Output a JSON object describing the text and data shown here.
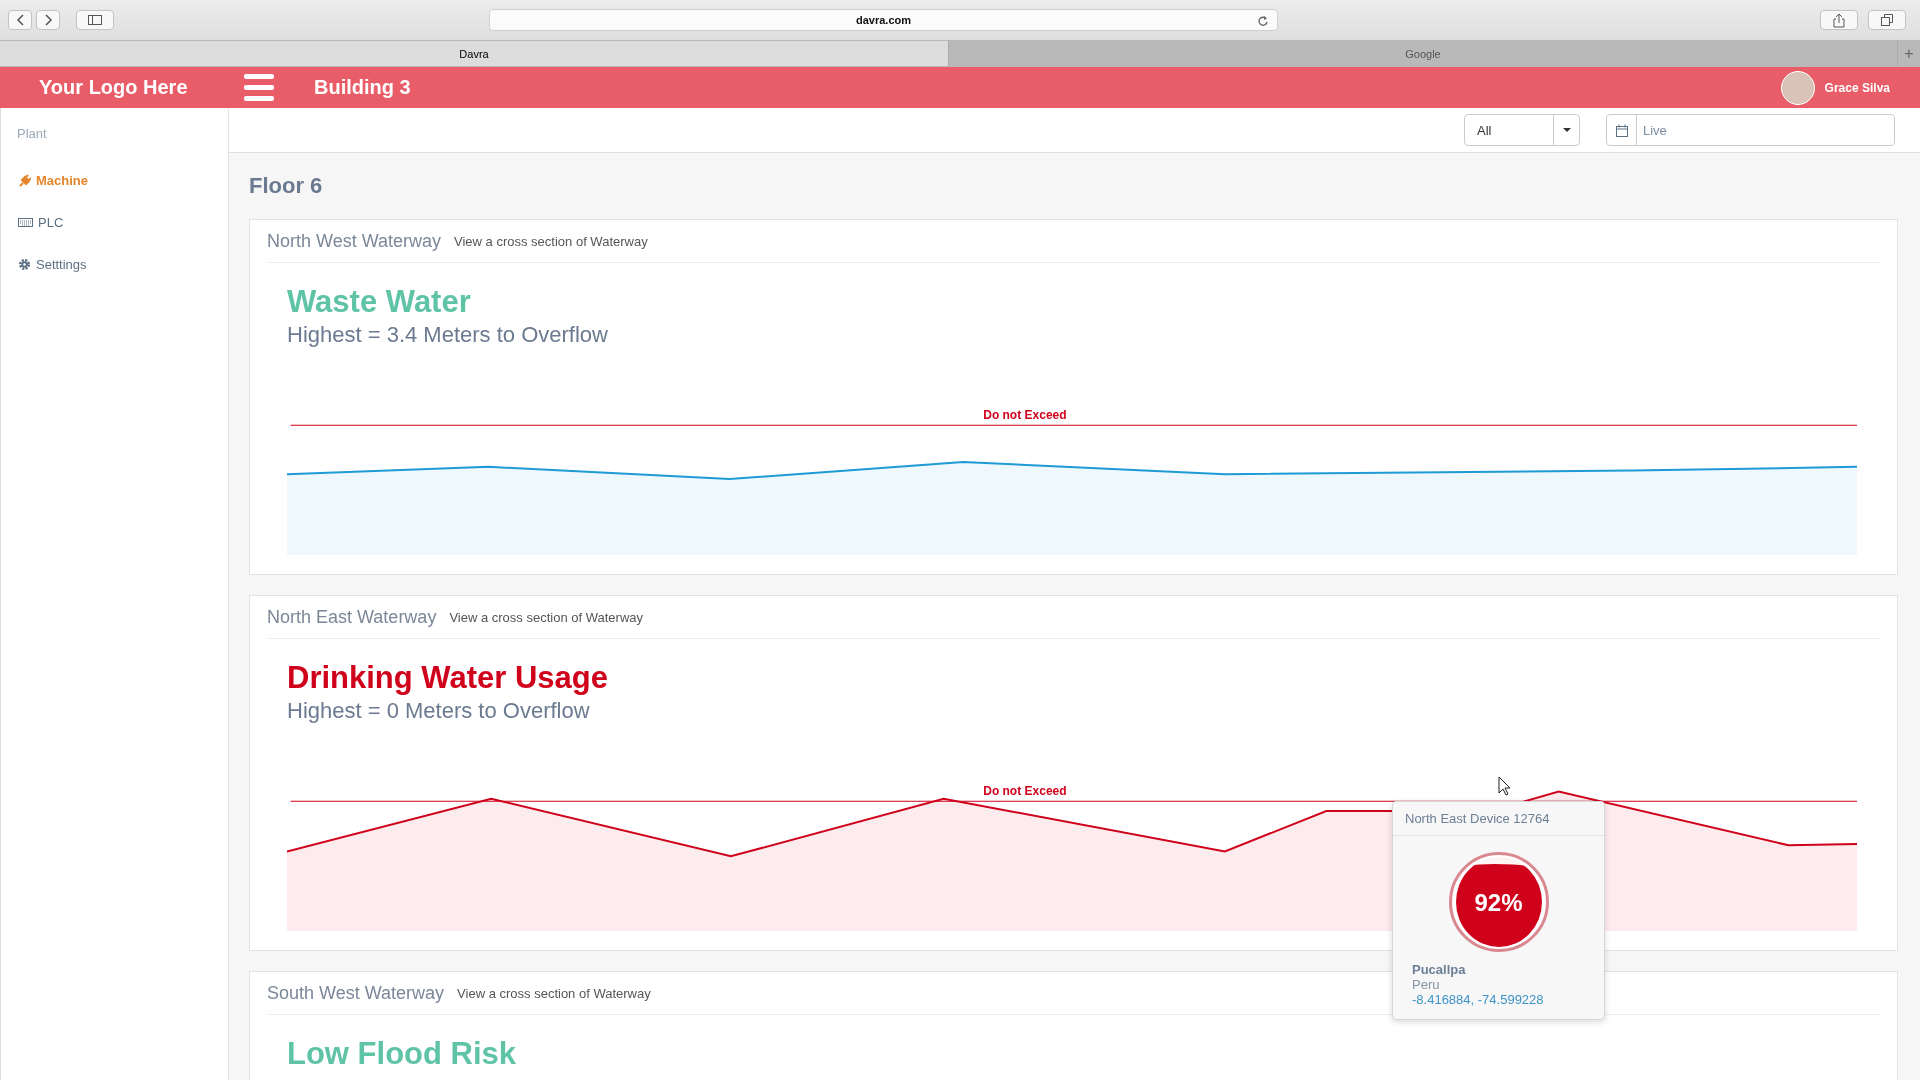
{
  "browser": {
    "url": "davra.com",
    "tabs": [
      {
        "label": "Davra",
        "selected": true
      },
      {
        "label": "Google",
        "selected": false
      }
    ],
    "new_tab": "+"
  },
  "header": {
    "logo": "Your Logo Here",
    "title": "Building 3",
    "user": "Grace Silva"
  },
  "sidebar": {
    "heading": "Plant",
    "items": [
      {
        "label": "Machine",
        "kind": "plug",
        "selected": true
      },
      {
        "label": "PLC",
        "kind": "keyboard",
        "selected": false
      },
      {
        "label": "Setttings",
        "kind": "gear",
        "selected": false
      }
    ]
  },
  "filters": {
    "select": "All",
    "date": {
      "placeholder": "Live"
    }
  },
  "page_title": "Floor 6",
  "cards": [
    {
      "name": "North West Waterway",
      "link": "View a cross section of Waterway",
      "title": "Waste Water",
      "subtitle": "Highest = 3.4 Meters to Overflow",
      "alert": false,
      "limit_label": "Do not Exceed"
    },
    {
      "name": "North East Waterway",
      "link": "View a cross section of Waterway",
      "title": "Drinking Water Usage",
      "subtitle": "Highest = 0 Meters to Overflow",
      "alert": true,
      "limit_label": "Do not Exceed"
    },
    {
      "name": "South West Waterway",
      "link": "View a cross section of Waterway",
      "title": "Low Flood Risk",
      "alert": false
    }
  ],
  "tooltip": {
    "title": "North East Device 12764",
    "gauge": {
      "level": 0.92,
      "reading": "92%"
    },
    "city": "Pucallpa",
    "country": "Peru",
    "coordinates": "-8.416884, -74.599228"
  }
}
